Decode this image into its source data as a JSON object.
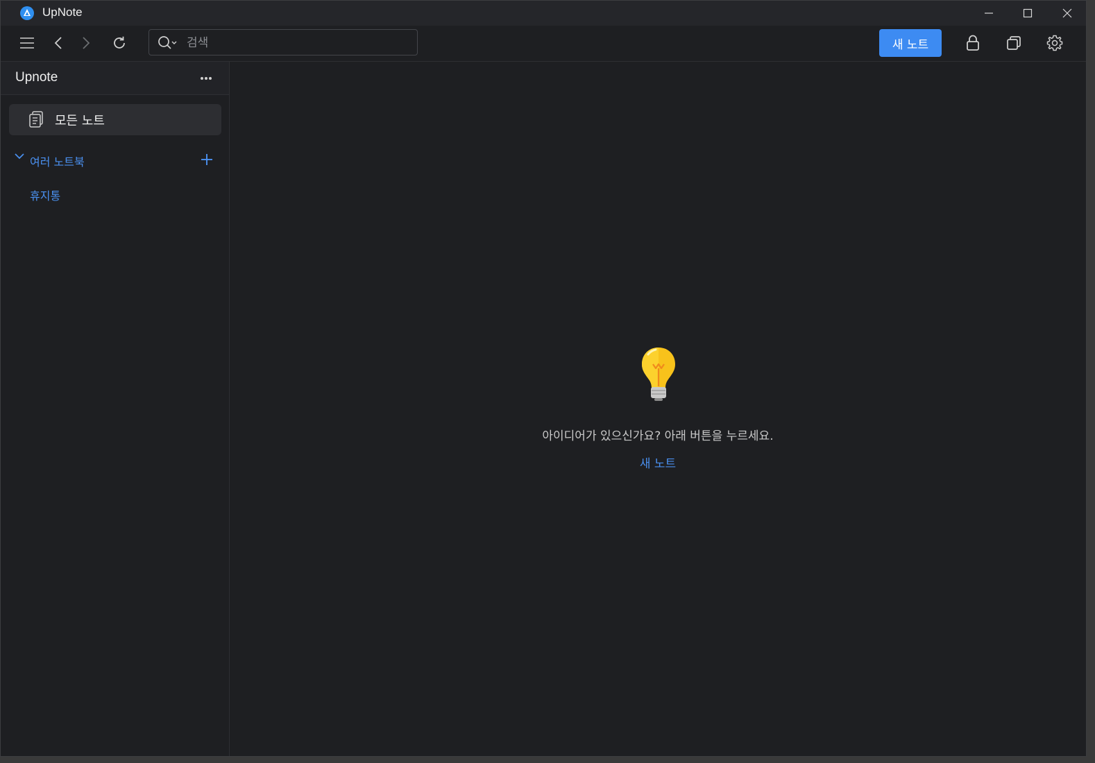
{
  "app": {
    "title": "UpNote",
    "icons": {
      "logo": "upnote-logo-icon",
      "minimize": "minimize-icon",
      "maximize": "maximize-icon",
      "close": "close-icon"
    }
  },
  "toolbar": {
    "search_placeholder": "검색",
    "new_note_label": "새 노트",
    "icons": [
      "menu-icon",
      "back-icon",
      "forward-icon",
      "refresh-icon",
      "search-icon",
      "lock-icon",
      "window-icon",
      "settings-icon"
    ]
  },
  "sidebar": {
    "title": "Upnote",
    "all_notes_label": "모든 노트",
    "notebooks_label": "여러 노트북",
    "trash_label": "휴지통"
  },
  "main": {
    "empty_message": "아이디어가 있으신가요? 아래 버튼을 누르세요.",
    "new_note_link": "새 노트"
  },
  "colors": {
    "accent": "#3d8bf2",
    "link": "#4a90f0",
    "background": "#1e1f22",
    "sidebar_selected": "#2d2e32"
  }
}
